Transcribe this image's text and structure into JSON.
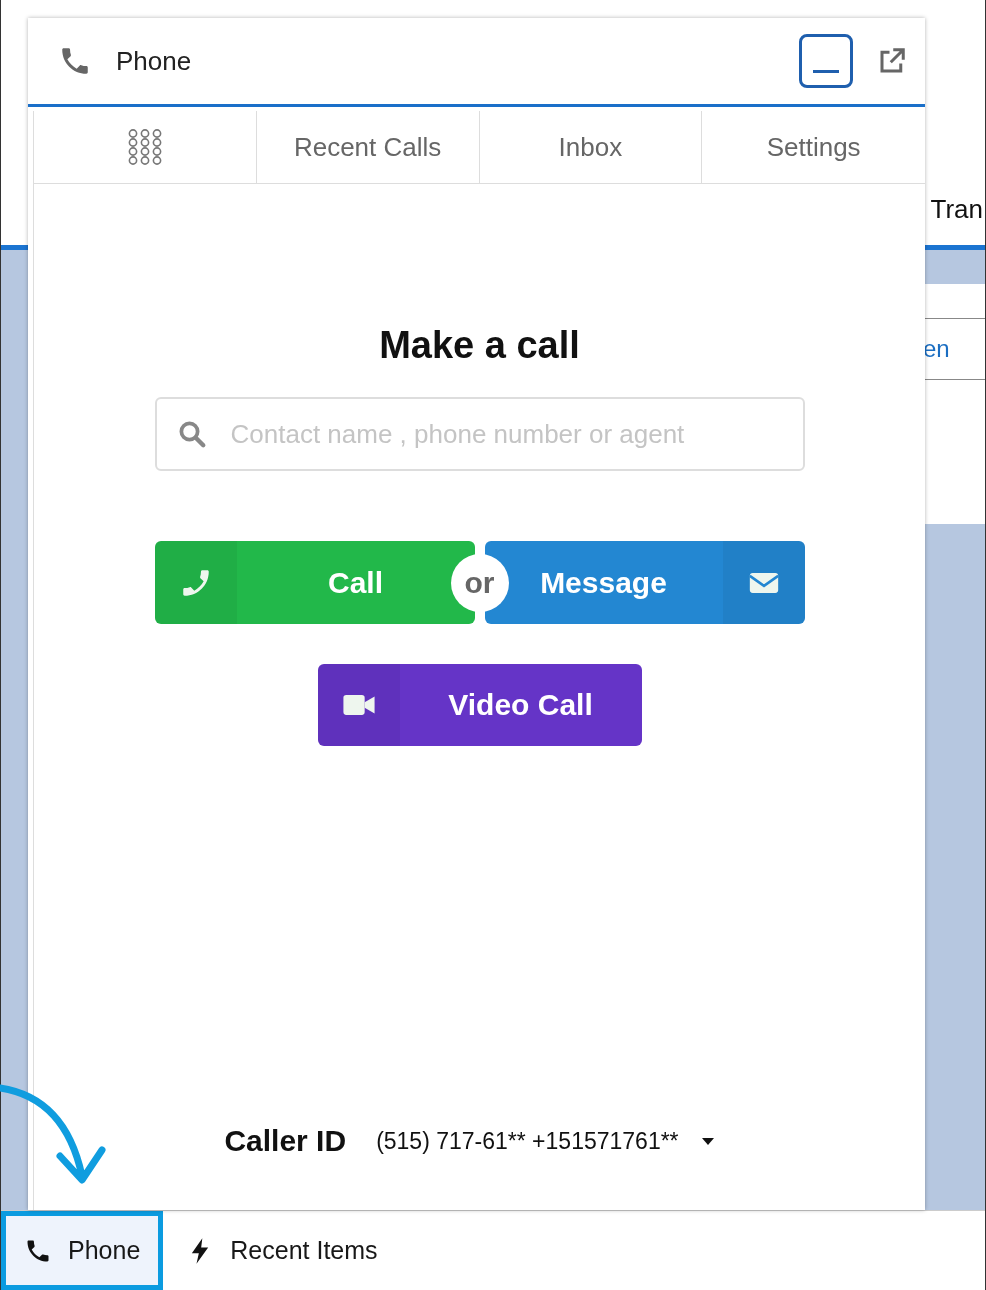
{
  "background": {
    "texts": [
      "Tran",
      "en"
    ]
  },
  "phone_panel": {
    "title": "Phone",
    "tabs": [
      {
        "kind": "dialpad"
      },
      {
        "kind": "text",
        "label": "Recent Calls"
      },
      {
        "kind": "text",
        "label": "Inbox"
      },
      {
        "kind": "text",
        "label": "Settings"
      }
    ],
    "heading": "Make a call",
    "search": {
      "placeholder": "Contact name , phone number or agent"
    },
    "call": {
      "label": "Call"
    },
    "separator": "or",
    "message": {
      "label": "Message"
    },
    "video": {
      "label": "Video Call"
    },
    "caller_id": {
      "label": "Caller ID",
      "value": "(515) 717-61** +151571761**"
    }
  },
  "utility_bar": {
    "items": [
      {
        "kind": "phone",
        "label": "Phone",
        "selected": true
      },
      {
        "kind": "recent",
        "label": "Recent Items",
        "selected": false
      }
    ]
  }
}
